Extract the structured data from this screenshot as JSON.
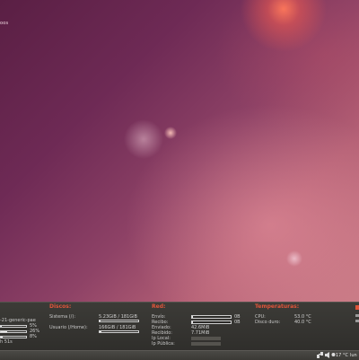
{
  "desktop": {
    "corner_text": "oos"
  },
  "panel": {
    "system": {
      "kernel": "-21-generic-pae",
      "rows": [
        "5%",
        "26%",
        "8%"
      ],
      "uptime": "h 51s"
    },
    "disks": {
      "title": "Discos:",
      "items": [
        {
          "label": "Sistema (/):",
          "value": "5.23GiB / 181GiB",
          "fill": 0.03
        },
        {
          "label": "Usuario (/Home):",
          "value": "166GiB / 181GiB",
          "fill": 0.04
        }
      ]
    },
    "network": {
      "title": "Red:",
      "envio_label": "Envío:",
      "recibo_label": "Recibo:",
      "enviado_label": "Enviado:",
      "enviado_value": "42.6MiB",
      "recibido_label": "Recibido:",
      "recibido_value": "7.71MiB",
      "ip_local_label": "Ip Local:",
      "ip_publica_label": "Ip Pública:",
      "bar_unit": "0B"
    },
    "temps": {
      "title": "Temperaturas:",
      "cpu_label": "CPU:",
      "cpu_value": "53.0 °C",
      "disk_label": "Disco duro:",
      "disk_value": "40.0 °C"
    }
  },
  "taskbar": {
    "network_icon": "network-icon",
    "volume_icon": "volume-icon",
    "weather_icon": "weather-icon",
    "temperature": "17 °C",
    "day": "lun"
  },
  "colors": {
    "accent": "#e0553a",
    "panel_bg": "#3c3b37"
  }
}
